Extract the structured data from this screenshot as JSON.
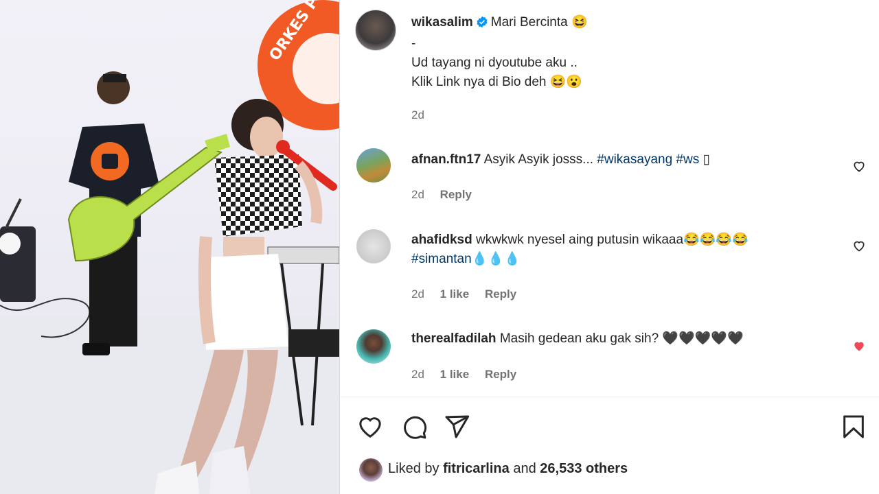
{
  "post": {
    "author": "wikasalim",
    "caption_title": "Mari Bercinta 😆",
    "caption_lines": [
      "-",
      "Ud tayang ni dyoutube aku ..",
      "Klik Link nya di Bio deh 😆😮"
    ],
    "time": "2d"
  },
  "media": {
    "banner_text": "ORKES P"
  },
  "comments": [
    {
      "username": "afnan.ftn17",
      "text": "Asyik Asyik josss...",
      "hashtags": [
        "#wikasayang",
        "#ws"
      ],
      "suffix": "▯",
      "time": "2d",
      "likes": "",
      "reply": "Reply",
      "liked": false
    },
    {
      "username": "ahafidksd",
      "text": "wkwkwk nyesel aing putusin wikaaa😂😂😂😂",
      "hashtags": [
        "#simantan💧💧💧"
      ],
      "time": "2d",
      "likes": "1 like",
      "reply": "Reply",
      "liked": false
    },
    {
      "username": "therealfadilah",
      "text": "Masih gedean aku gak sih? 🖤🖤🖤🖤🖤",
      "time": "2d",
      "likes": "1 like",
      "reply": "Reply",
      "liked": true
    }
  ],
  "likes": {
    "prefix": "Liked by",
    "user": "fitricarlina",
    "connector": "and",
    "count": "26,533 others"
  },
  "icons": {
    "like": "heart-icon",
    "comment": "comment-icon",
    "share": "send-icon",
    "save": "bookmark-icon",
    "verified": "verified-badge-icon"
  },
  "colors": {
    "link": "#00376b",
    "liked_heart": "#ed4956",
    "verified": "#0095f6",
    "muted": "#737373"
  }
}
